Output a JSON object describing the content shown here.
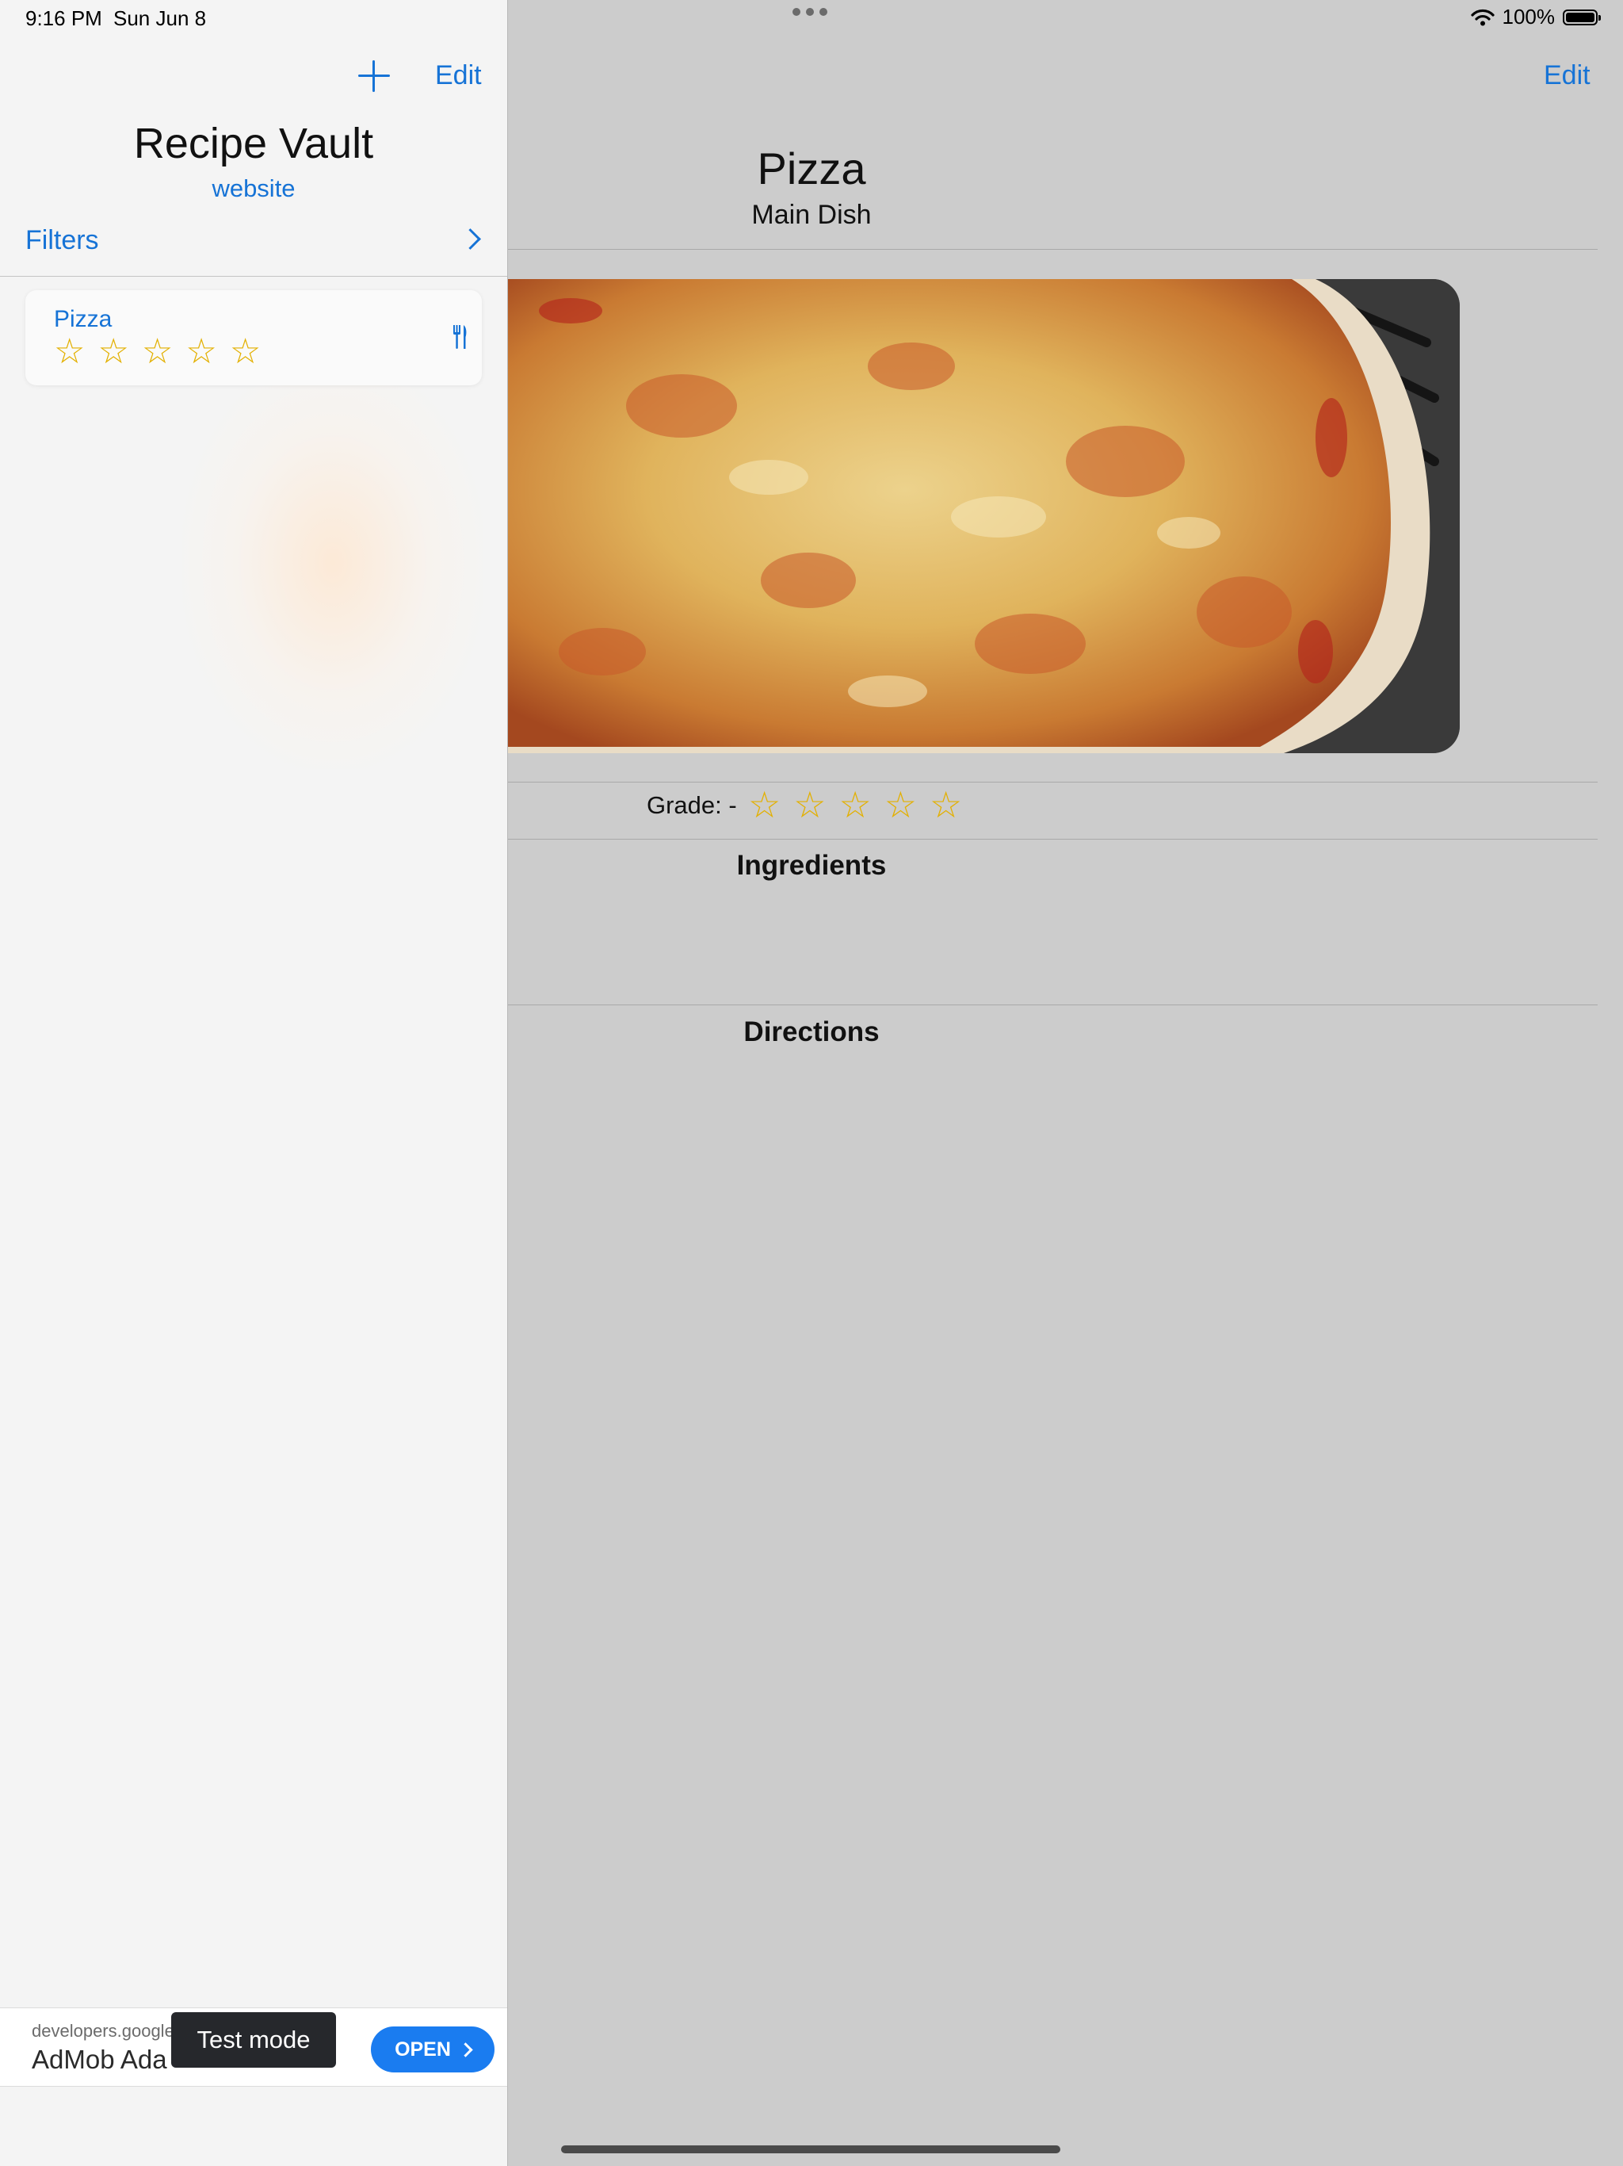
{
  "status": {
    "time": "9:16 PM",
    "date": "Sun Jun 8",
    "battery": "100%"
  },
  "sidebar": {
    "add_icon": "plus-icon",
    "edit_label": "Edit",
    "app_title": "Recipe Vault",
    "website_label": "website",
    "filters_label": "Filters",
    "recipes": [
      {
        "name": "Pizza",
        "rating": 0,
        "max_rating": 5,
        "icon": "fork-knife-icon"
      }
    ]
  },
  "ad": {
    "domain": "developers.google",
    "title": "AdMob Ada",
    "test_mode": "Test mode",
    "open_label": "OPEN"
  },
  "detail": {
    "edit_label": "Edit",
    "title": "Pizza",
    "category": "Main Dish",
    "image": "pizza-photo",
    "grade_label": "Grade: -",
    "grade_rating": 0,
    "ingredients_heading": "Ingredients",
    "directions_heading": "Directions"
  },
  "colors": {
    "accent": "#1673d6",
    "star": "#e3b000",
    "detail_background": "#cccccc",
    "sidebar_background": "#f4f4f4"
  }
}
